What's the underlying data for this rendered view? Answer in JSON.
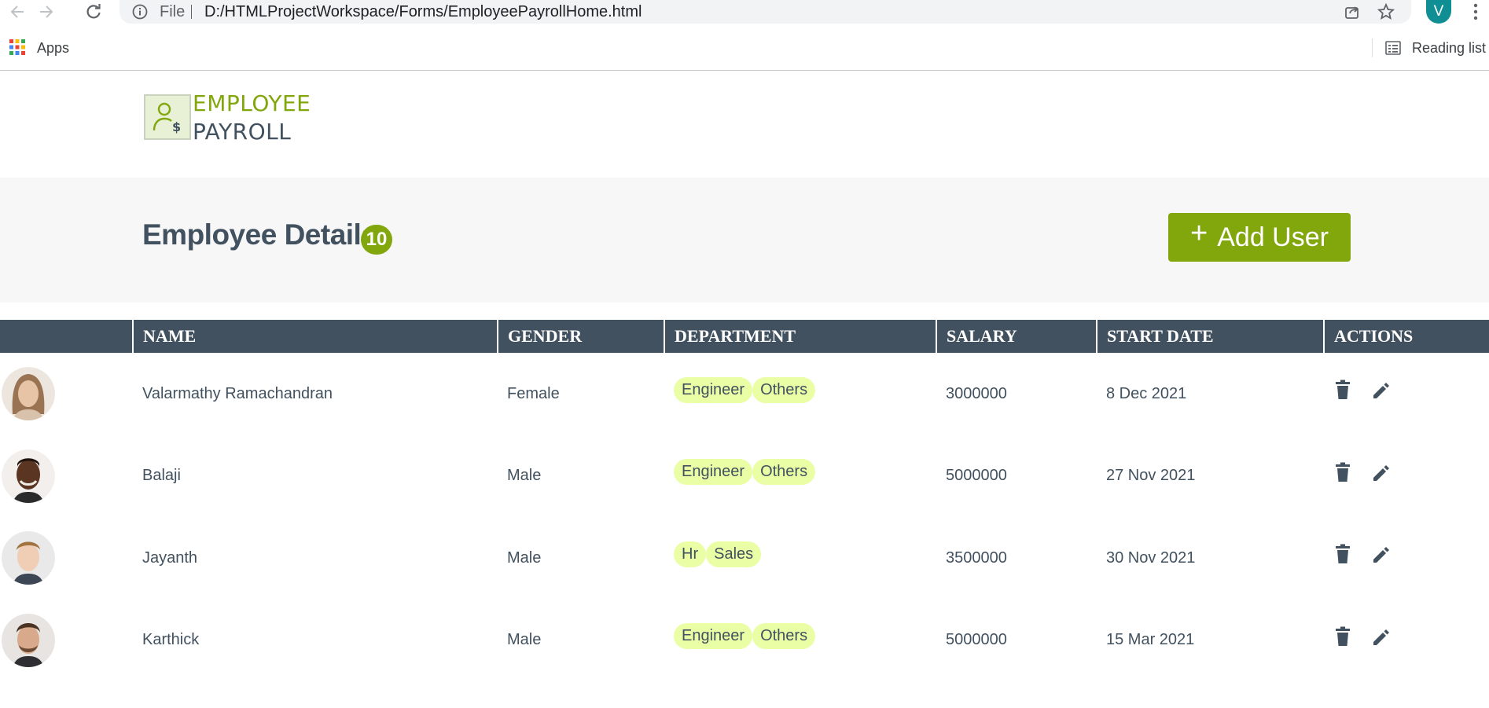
{
  "browser": {
    "file_label": "File",
    "url": "D:/HTMLProjectWorkspace/Forms/EmployeePayrollHome.html",
    "profile_initial": "V",
    "bookmarks": {
      "apps_label": "Apps",
      "reading_list_label": "Reading list"
    }
  },
  "header": {
    "logo_line1": "EMPLOYEE",
    "logo_line2": "PAYROLL"
  },
  "title_band": {
    "title": "Employee Details",
    "count": "10",
    "add_button_plus": "+",
    "add_button_label": "Add User"
  },
  "table": {
    "columns": [
      "",
      "NAME",
      "GENDER",
      "DEPARTMENT",
      "SALARY",
      "START DATE",
      "ACTIONS"
    ],
    "rows": [
      {
        "name": "Valarmathy Ramachandran",
        "gender": "Female",
        "departments": [
          "Engineer",
          "Others"
        ],
        "salary": "3000000",
        "start_date": "8 Dec 2021"
      },
      {
        "name": "Balaji",
        "gender": "Male",
        "departments": [
          "Engineer",
          "Others"
        ],
        "salary": "5000000",
        "start_date": "27 Nov 2021"
      },
      {
        "name": "Jayanth",
        "gender": "Male",
        "departments": [
          "Hr",
          "Sales"
        ],
        "salary": "3500000",
        "start_date": "30 Nov 2021"
      },
      {
        "name": "Karthick",
        "gender": "Male",
        "departments": [
          "Engineer",
          "Others"
        ],
        "salary": "5000000",
        "start_date": "15 Mar 2021"
      }
    ]
  },
  "colors": {
    "accent": "#82a70c",
    "header_dark": "#42515f",
    "chip_bg": "#e9fea5",
    "band_bg": "#f7f7f7"
  },
  "icons": [
    "back-arrow-icon",
    "forward-arrow-icon",
    "reload-icon",
    "info-icon",
    "share-icon",
    "star-icon",
    "apps-grid-icon",
    "reading-list-icon",
    "delete-icon",
    "edit-icon"
  ]
}
